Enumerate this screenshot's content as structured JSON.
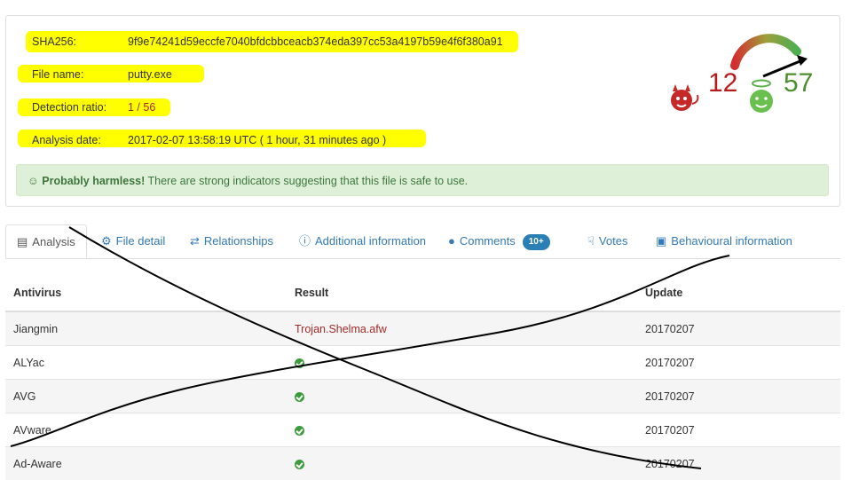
{
  "summary": {
    "sha256_label": "SHA256:",
    "sha256_value": "9f9e74241d59eccfe7040bfdcbbceacb374eda397cc53a4197b59e4f6f380a91",
    "filename_label": "File name:",
    "filename_value": "putty.exe",
    "detection_label": "Detection ratio:",
    "detection_value": "1 / 56",
    "date_label": "Analysis date:",
    "date_value": "2017-02-07 13:58:19 UTC ( 1 hour, 31 minutes ago )"
  },
  "alert": {
    "icon": "smile-icon",
    "strong": "Probably harmless!",
    "text": " There are strong indicators suggesting that this file is safe to use."
  },
  "community": {
    "bad_score": "12",
    "good_score": "57",
    "bad_color": "#b71c1c",
    "good_color": "#4b8f2b"
  },
  "tabs": [
    {
      "label": "Analysis",
      "icon": "table-icon"
    },
    {
      "label": "File detail",
      "icon": "zoom-icon"
    },
    {
      "label": "Relationships",
      "icon": "shuffle-icon"
    },
    {
      "label": "Additional information",
      "icon": "info-icon"
    },
    {
      "label": "Comments",
      "icon": "comment-icon",
      "badge": "10+"
    },
    {
      "label": "Votes",
      "icon": "thumbs-down-icon"
    },
    {
      "label": "Behavioural information",
      "icon": "film-icon"
    }
  ],
  "table": {
    "headers": [
      "Antivirus",
      "Result",
      "Update"
    ],
    "rows": [
      {
        "antivirus": "Jiangmin",
        "result": "Trojan.Shelma.afw",
        "update": "20170207"
      },
      {
        "antivirus": "ALYac",
        "result": "",
        "update": "20170207"
      },
      {
        "antivirus": "AVG",
        "result": "",
        "update": "20170207"
      },
      {
        "antivirus": "AVware",
        "result": "",
        "update": "20170207"
      },
      {
        "antivirus": "Ad-Aware",
        "result": "",
        "update": "20170207"
      }
    ]
  }
}
